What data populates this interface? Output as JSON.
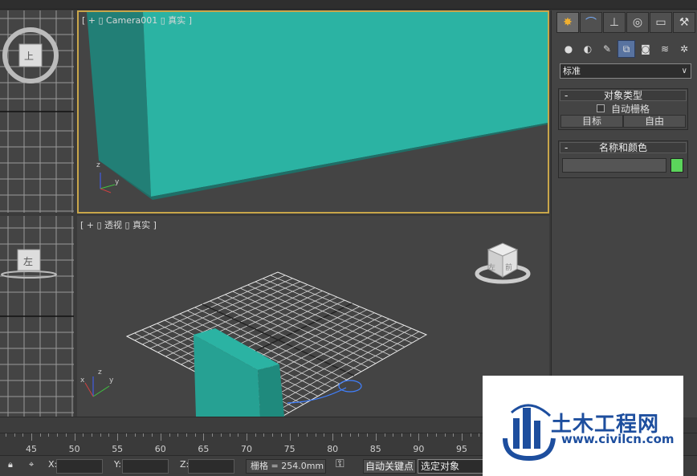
{
  "viewports": {
    "camera": {
      "label": "[ + ▯ Camera001 ▯ 真实 ]"
    },
    "perspective": {
      "label": "[ + ▯ 透视 ▯ 真实 ]"
    },
    "top_view_cube": {
      "face": "上"
    },
    "left_view_cube": {
      "face": "左"
    },
    "persp_cube_faces": [
      "左",
      "前"
    ],
    "axis": {
      "x": "x",
      "y": "y",
      "z": "z"
    }
  },
  "command_panel": {
    "tabs": [
      "create-icon",
      "modify-icon",
      "hierarchy-icon",
      "motion-icon",
      "display-icon",
      "utilities-icon"
    ],
    "active_tab": 0,
    "subtabs": [
      "geometry-icon",
      "shapes-icon",
      "lights-icon",
      "cameras-icon",
      "helpers-icon",
      "spacewarps-icon",
      "systems-icon"
    ],
    "active_subtab": 3,
    "category_dropdown": "标准",
    "object_type": {
      "title": "对象类型",
      "collapse": "-",
      "autogrid_label": "自动栅格",
      "buttons": [
        "目标",
        "自由"
      ]
    },
    "name_color": {
      "title": "名称和颜色",
      "collapse": "-",
      "name_value": "",
      "swatch_color": "#5bd45b"
    }
  },
  "timeline": {
    "tick_labels": [
      "45",
      "50",
      "55",
      "60",
      "65",
      "70",
      "75",
      "80",
      "85",
      "90",
      "95"
    ]
  },
  "status_bar": {
    "x_label": "X:",
    "y_label": "Y:",
    "z_label": "Z:",
    "x_value": "",
    "y_value": "",
    "z_value": "",
    "grid_readout": "栅格 = 254.0mm",
    "autokey": "自动关键点",
    "selection_set": "选定对象"
  },
  "watermark": {
    "cn": "土木工程网",
    "en": "www.civilcn.com"
  },
  "colors": {
    "teal": "#2bb3a3",
    "viewport_bg": "#444444",
    "active_border": "#c8a64a"
  }
}
